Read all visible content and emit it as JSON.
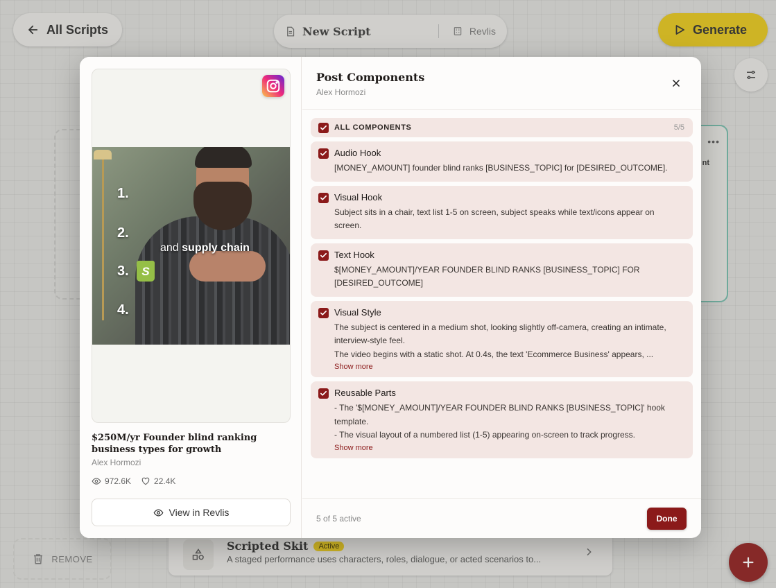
{
  "header": {
    "back_label": "All Scripts",
    "script_title": "New Script",
    "workspace": "Revlis",
    "generate_label": "Generate"
  },
  "background": {
    "card_partial_text": "nt",
    "remove_label": "REMOVE",
    "skit_title": "Scripted Skit",
    "skit_badge": "Active",
    "skit_desc": "A staged performance uses characters, roles, dialogue, or acted scenarios to..."
  },
  "modal": {
    "title": "Post Components",
    "subtitle": "Alex Hormozi",
    "post": {
      "title": "$250M/yr Founder blind ranking business types for growth",
      "author": "Alex Hormozi",
      "views": "972.6K",
      "likes": "22.4K",
      "view_button": "View in Revlis",
      "video_numbers": [
        "1.",
        "2.",
        "3.",
        "4."
      ],
      "video_caption_plain": "and ",
      "video_caption_bold": "supply chain",
      "shop_glyph": "S"
    },
    "all_components_label": "ALL COMPONENTS",
    "all_components_count": "5/5",
    "components": [
      {
        "name": "Audio Hook",
        "lines": [
          "[MONEY_AMOUNT] founder blind ranks [BUSINESS_TOPIC] for [DESIRED_OUTCOME]."
        ],
        "more": ""
      },
      {
        "name": "Visual Hook",
        "lines": [
          "Subject sits in a chair, text list 1-5 on screen, subject speaks while text/icons appear on screen."
        ],
        "more": ""
      },
      {
        "name": "Text Hook",
        "lines": [
          "$[MONEY_AMOUNT]/YEAR FOUNDER BLIND RANKS [BUSINESS_TOPIC] FOR [DESIRED_OUTCOME]"
        ],
        "more": ""
      },
      {
        "name": "Visual Style",
        "lines": [
          "The subject is centered in a medium shot, looking slightly off-camera, creating an intimate, interview-style feel.",
          "The video begins with a static shot. At 0.4s, the text 'Ecommerce Business' appears, ..."
        ],
        "more": "Show more"
      },
      {
        "name": "Reusable Parts",
        "lines": [
          "- The '$[MONEY_AMOUNT]/YEAR FOUNDER BLIND RANKS [BUSINESS_TOPIC]' hook template.",
          "- The visual layout of a numbered list (1-5) appearing on-screen to track progress."
        ],
        "more": "Show more"
      }
    ],
    "footer_status": "5 of 5 active",
    "done_label": "Done"
  },
  "colors": {
    "accent": "#8b1a1a",
    "generate": "#e3c417",
    "teal": "#6fb8a8"
  }
}
